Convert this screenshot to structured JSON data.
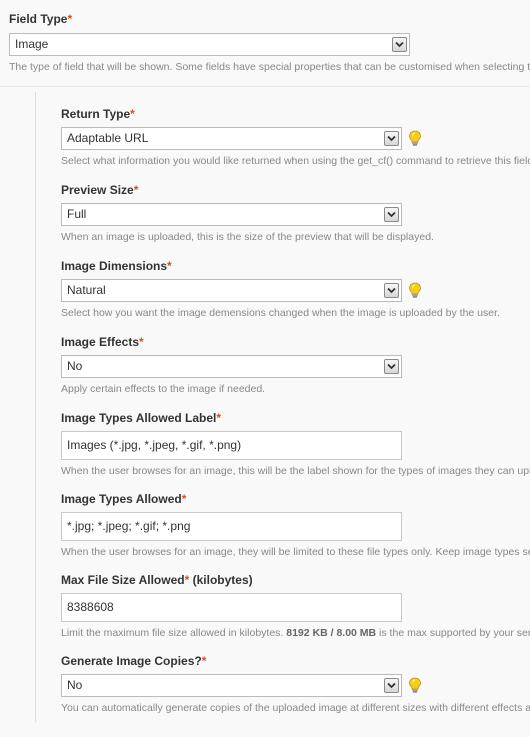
{
  "field_type": {
    "label": "Field Type",
    "required_mark": "*",
    "value": "Image",
    "description": "The type of field that will be shown. Some fields have special properties that can be customised when selecting them."
  },
  "fields": [
    {
      "label": "Return Type",
      "required_mark": "*",
      "control": "select",
      "value": "Adaptable URL",
      "has_help_icon": true,
      "description": "Select what information you would like returned when using the get_cf() command to retrieve this field."
    },
    {
      "label": "Preview Size",
      "required_mark": "*",
      "control": "select",
      "value": "Full",
      "has_help_icon": false,
      "description": "When an image is uploaded, this is the size of the preview that will be displayed."
    },
    {
      "label": "Image Dimensions",
      "required_mark": "*",
      "control": "select",
      "value": "Natural",
      "has_help_icon": true,
      "description": "Select how you want the image demensions changed when the image is uploaded by the user."
    },
    {
      "label": "Image Effects",
      "required_mark": "*",
      "control": "select",
      "value": "No",
      "has_help_icon": false,
      "description": "Apply certain effects to the image if needed."
    },
    {
      "label": "Image Types Allowed Label",
      "required_mark": "*",
      "control": "input",
      "value": "Images (*.jpg, *.jpeg, *.gif, *.png)",
      "has_help_icon": false,
      "description": "When the user browses for an image, this will be the label shown for the types of images they can upload."
    },
    {
      "label": "Image Types Allowed",
      "required_mark": "*",
      "control": "input",
      "value": "*.jpg; *.jpeg; *.gif; *.png",
      "has_help_icon": false,
      "description": "When the user browses for an image, they will be limited to these file types only. Keep image types separated by semicolons."
    },
    {
      "label": "Max File Size Allowed",
      "required_mark": "*",
      "label_suffix": " (kilobytes)",
      "control": "input",
      "value": "8388608",
      "has_help_icon": false,
      "description_pre": "Limit the maximum file size allowed in kilobytes. ",
      "description_bold": "8192 KB / 8.00 MB",
      "description_post": " is the max supported by your server."
    },
    {
      "label": "Generate Image Copies?",
      "required_mark": "*",
      "control": "select",
      "value": "No",
      "has_help_icon": true,
      "description": "You can automatically generate copies of the uploaded image at different sizes with different effects applied."
    }
  ],
  "icons": {
    "select_arrow": "chevron-down-icon",
    "help": "lightbulb-icon"
  },
  "colors": {
    "required": "#d54e21",
    "help_bulb": "#f2c200"
  }
}
